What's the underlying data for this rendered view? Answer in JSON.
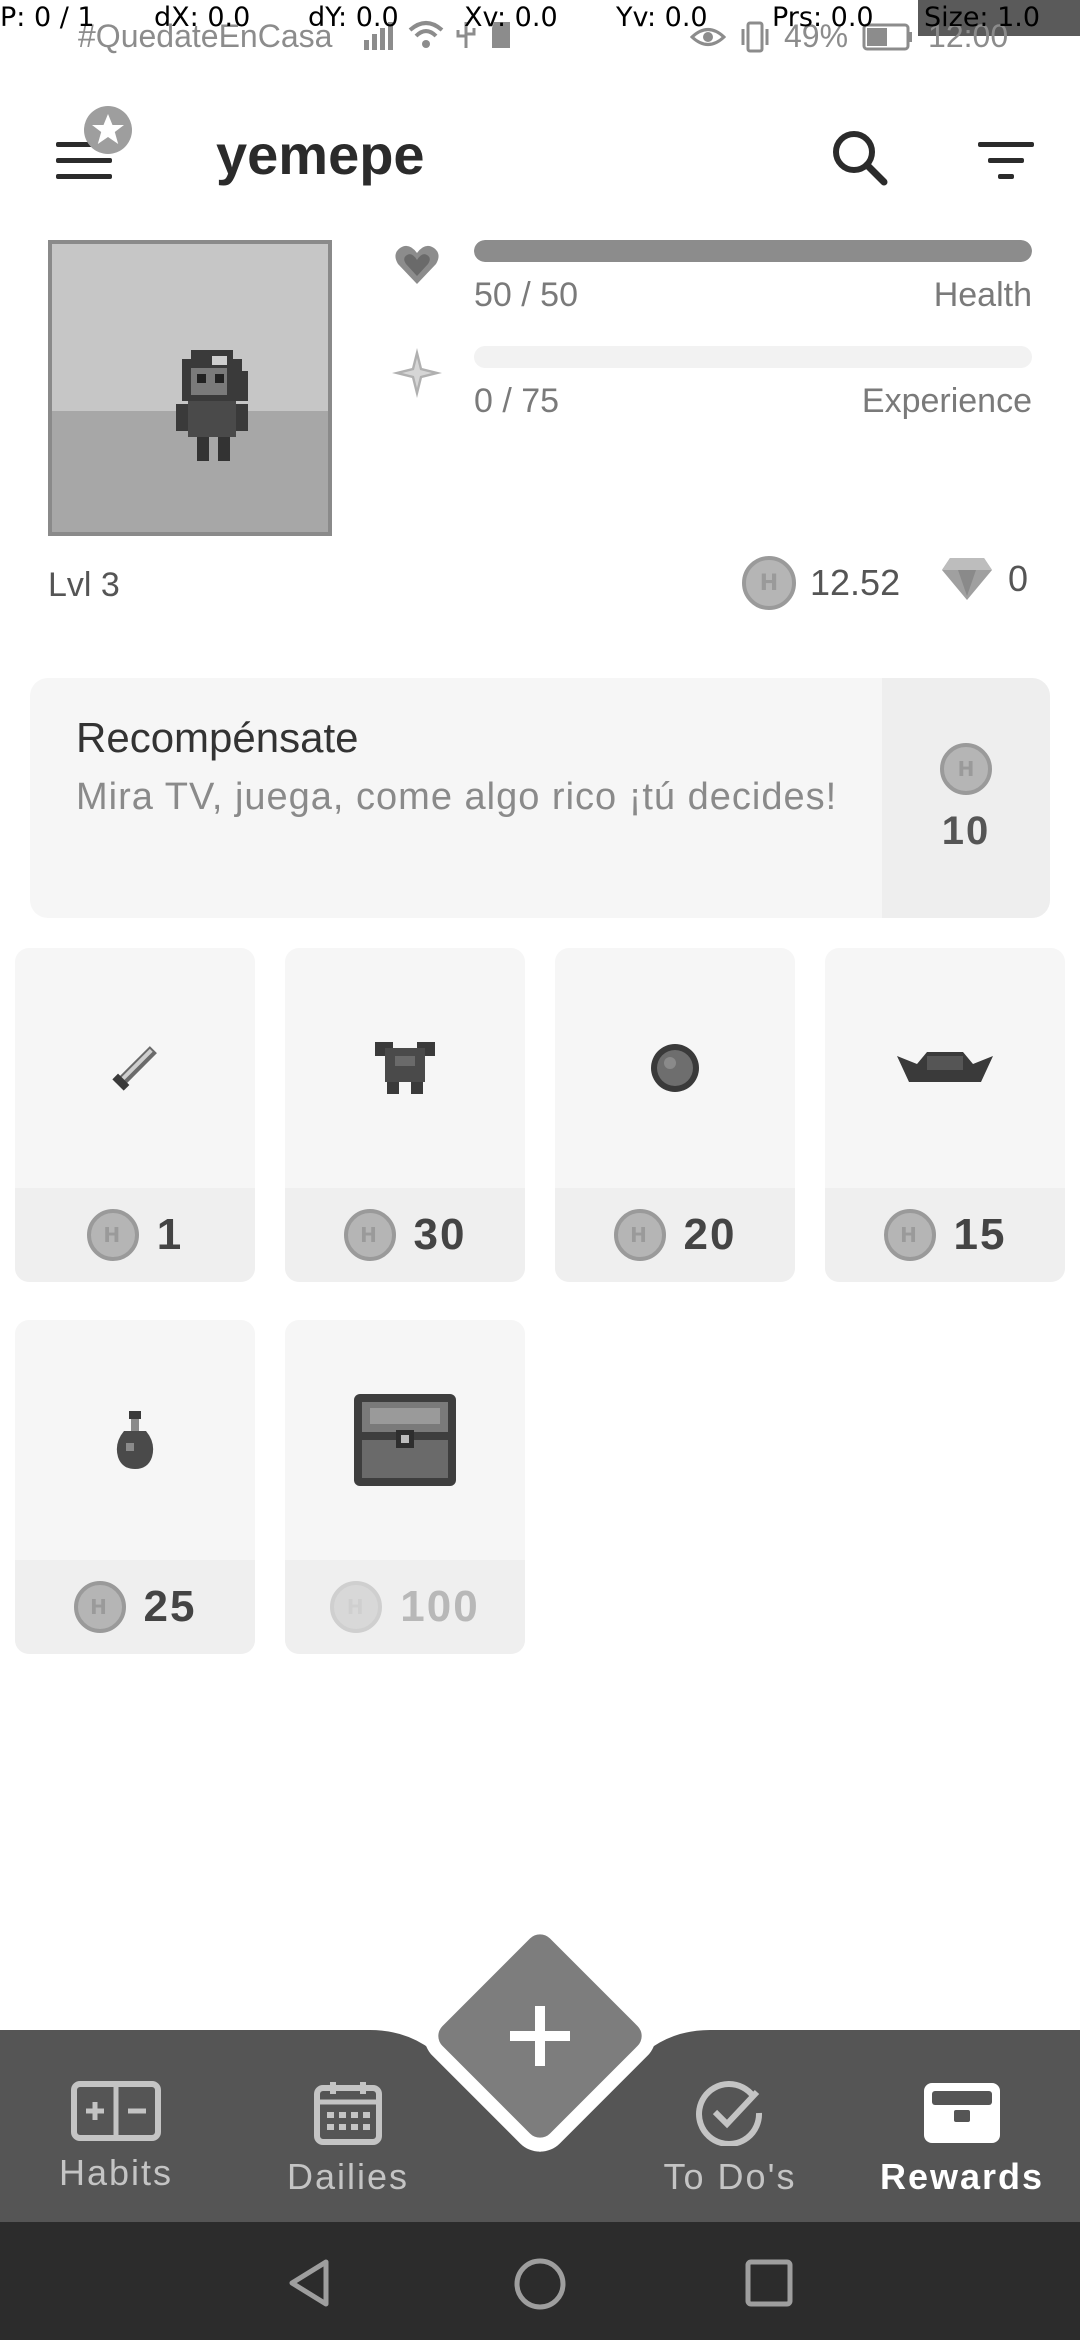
{
  "debug": {
    "pointer": "P: 0 / 1",
    "dx": "dX: 0.0",
    "dy": "dY: 0.0",
    "xv": "Xv: 0.0",
    "yv": "Yv: 0.0",
    "prs": "Prs: 0.0",
    "size": "Size: 1.0"
  },
  "status_bar": {
    "carrier_text": "#QuedateEnCasa",
    "battery": "49%",
    "time": "12:00"
  },
  "toolbar": {
    "title": "yemepe"
  },
  "stats": {
    "health": {
      "value": "50 / 50",
      "label": "Health",
      "fraction": 1.0
    },
    "experience": {
      "value": "0 / 75",
      "label": "Experience",
      "fraction": 0.0
    },
    "level": "Lvl 3",
    "gold": "12.52",
    "gems": "0"
  },
  "custom_reward": {
    "title": "Recompénsate",
    "notes": "Mira TV, juega, come algo rico ¡tú decides!",
    "cost": "10"
  },
  "shop_items": [
    {
      "icon": "weapon-icon",
      "price": "1"
    },
    {
      "icon": "armor-icon",
      "price": "30"
    },
    {
      "icon": "shield-icon",
      "price": "20"
    },
    {
      "icon": "hat-icon",
      "price": "15"
    },
    {
      "icon": "potion-icon",
      "price": "25"
    },
    {
      "icon": "chest-icon",
      "price": "100",
      "affordable": false
    }
  ],
  "bottom_nav": {
    "habits": "Habits",
    "dailies": "Dailies",
    "todos": "To Do's",
    "rewards": "Rewards"
  },
  "colors": {
    "nav_background": "#555555",
    "fab": "#7d7d7d",
    "health_bar": "#8c8c8c"
  }
}
